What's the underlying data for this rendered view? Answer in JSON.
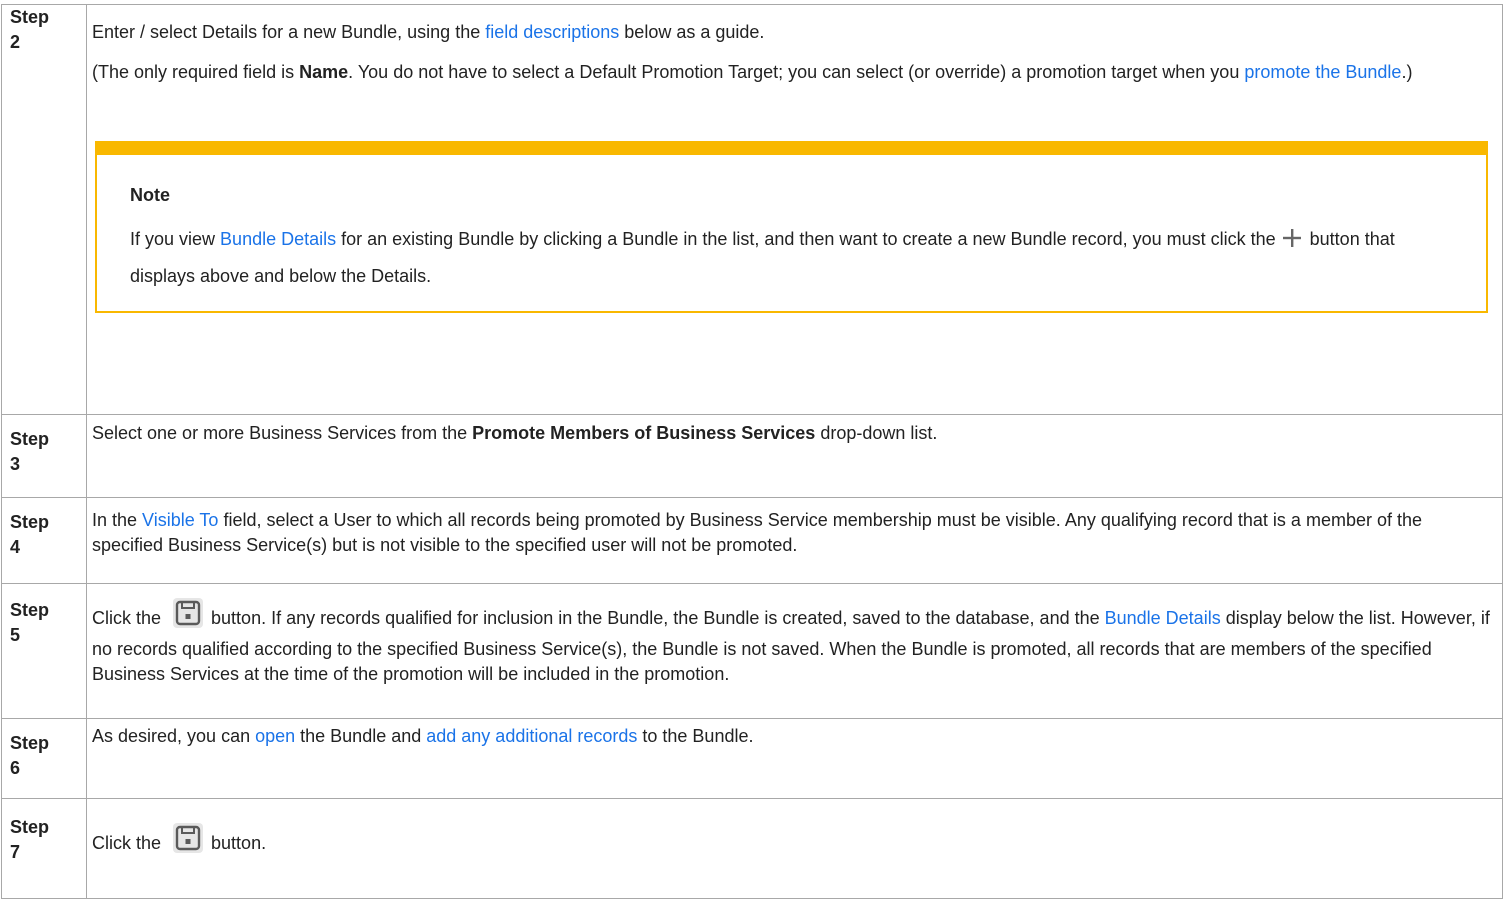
{
  "steps": [
    {
      "label": "Step 2",
      "text": {
        "intro": "Enter / select Details for a new Bundle, using the ",
        "link1": "field descriptions",
        "after_link1": " below as a guide.",
        "para2_open": "(The only required field is ",
        "bold_name": "Name",
        "para2_mid": ". You do not have to select a Default Promotion Target; you can select (or override) a promotion target when you ",
        "link2": "promote the Bundle",
        "para2_close": ".)"
      },
      "note": {
        "title": "Note",
        "before_link": "If you view ",
        "link": "Bundle Details",
        "after_link": " for an existing Bundle by clicking a Bundle in the list, and then want to create a new Bundle record, you must click the",
        "after_icon": "button that displays above and below the Details."
      }
    },
    {
      "label": "Step 3",
      "text": {
        "before": "Select one or more Business Services from the ",
        "bold": "Promote Members of Business Services",
        "after": " drop-down list."
      }
    },
    {
      "label": "Step 4",
      "text": {
        "before": "In the ",
        "link": "Visible To",
        "after": " field, select a User to which all records being promoted by Business Service membership must be visible. Any qualifying record that is a member of the specified Business Service(s) but is not visible to the specified user will not be promoted."
      }
    },
    {
      "label": "Step 5",
      "text": {
        "before_icon": "Click the",
        "after_icon": "button. If any records qualified for inclusion in the Bundle, the Bundle is created, saved to the database, and the ",
        "link": "Bundle Details",
        "after_link": " display below the list. However, if no records qualified according to the specified Business Service(s), the Bundle is not saved. When the Bundle is promoted, all records that are members of the specified Business Services at the time of the promotion will be included in the promotion."
      }
    },
    {
      "label": "Step 6",
      "text": {
        "before": "As desired, you can ",
        "link1": "open",
        "middle": " the Bundle and ",
        "link2": "add any additional records",
        "after": " to the Bundle."
      }
    },
    {
      "label": "Step 7",
      "text": {
        "before_icon": "Click the",
        "after_icon": "button."
      }
    }
  ],
  "icons": {
    "plus": "plus-icon",
    "save": "save-icon"
  },
  "colors": {
    "link": "#1a73e8",
    "note_accent": "#f9b800",
    "border": "#a8a8a8"
  }
}
